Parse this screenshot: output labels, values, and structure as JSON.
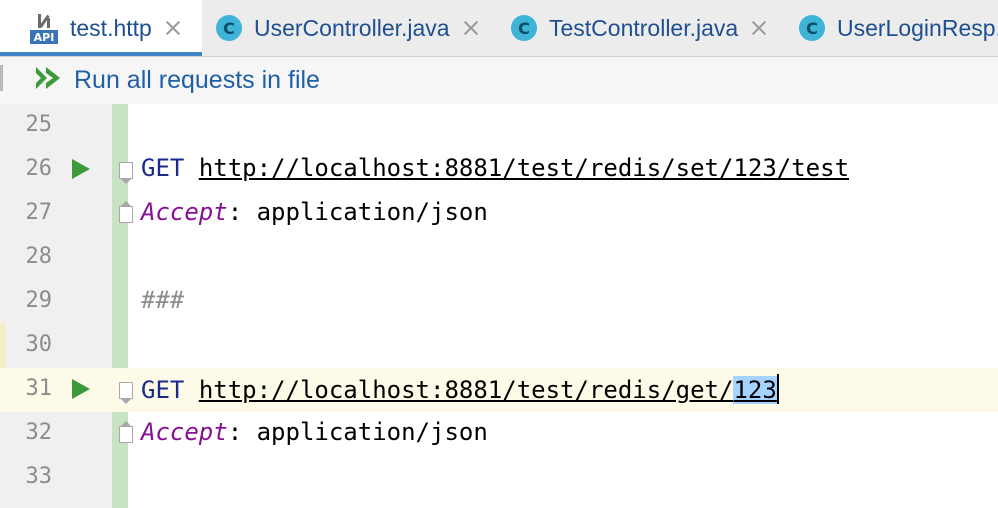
{
  "tabs": [
    {
      "label": "test.http",
      "icon": "api-file-icon",
      "active": true,
      "closable": true
    },
    {
      "label": "UserController.java",
      "icon": "class-icon",
      "icon_letter": "C",
      "active": false,
      "closable": true
    },
    {
      "label": "TestController.java",
      "icon": "class-icon",
      "icon_letter": "C",
      "active": false,
      "closable": true
    },
    {
      "label": "UserLoginResp.j",
      "icon": "class-icon",
      "icon_letter": "C",
      "active": false,
      "closable": false
    }
  ],
  "api_icon_text": "API",
  "toolbar": {
    "run_all_label": "Run all requests in file"
  },
  "editor": {
    "lines": [
      {
        "number": "25"
      },
      {
        "number": "26",
        "method": "GET",
        "url": "http://localhost:8881/test/redis/set/123/test"
      },
      {
        "number": "27",
        "header_name": "Accept",
        "header_sep": ": ",
        "header_value": "application/json"
      },
      {
        "number": "28"
      },
      {
        "number": "29",
        "comment": "###"
      },
      {
        "number": "30"
      },
      {
        "number": "31",
        "method": "GET",
        "url_prefix": "http://localhost:8881/test/redis/get/",
        "url_selected": "123"
      },
      {
        "number": "32",
        "header_name": "Accept",
        "header_sep": ": ",
        "header_value": "application/json"
      },
      {
        "number": "33"
      }
    ]
  },
  "colors": {
    "accent": "#4083c9",
    "run_icon": "#3c9a3c",
    "vcs_added": "#c7e3c1",
    "current_line": "#fdfbe7",
    "selection": "#a6d2ff"
  }
}
